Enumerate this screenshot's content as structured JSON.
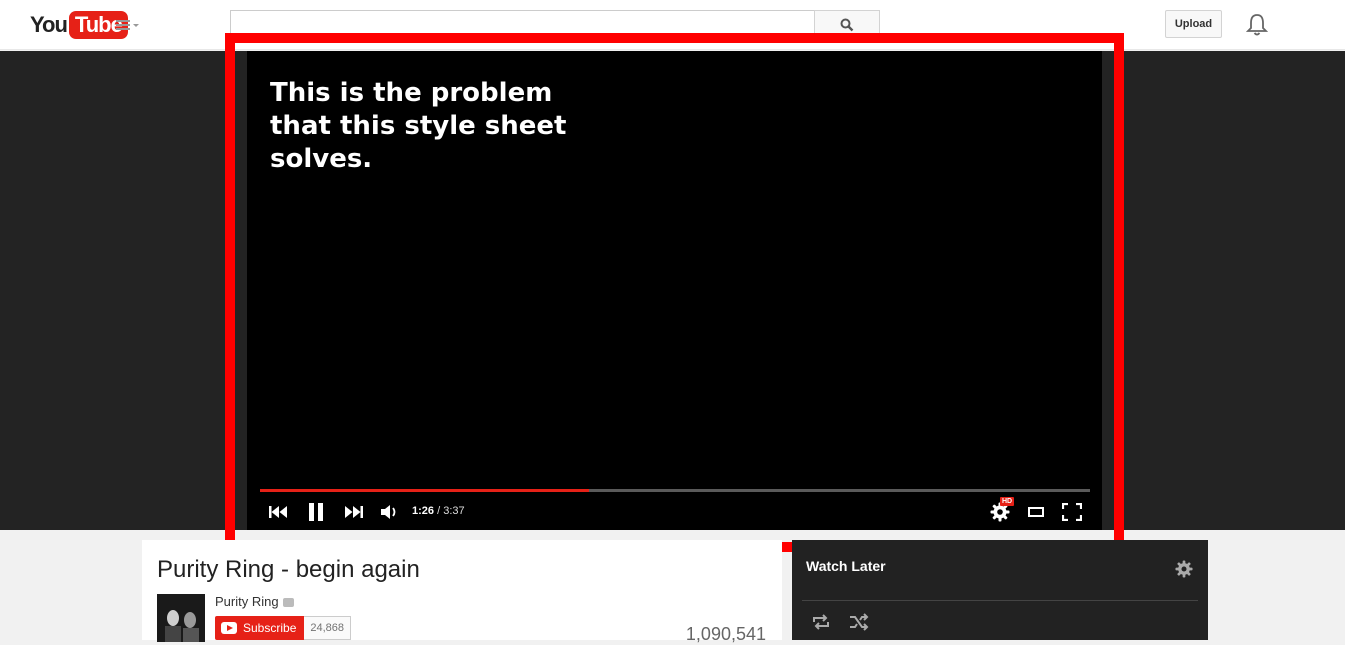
{
  "masthead": {
    "logo_you": "You",
    "logo_tube": "Tube",
    "search_placeholder": "",
    "upload_label": "Upload"
  },
  "player": {
    "caption": "This is the problem that this style sheet solves.",
    "current_time": "1:26",
    "duration": " / 3:37",
    "progress_fraction": 0.396,
    "hd_badge": "HD"
  },
  "video": {
    "title": "Purity Ring - begin again",
    "channel": "Purity Ring",
    "subscribe_label": "Subscribe",
    "subscriber_count": "24,868",
    "views": "1,090,541"
  },
  "playlist": {
    "title": "Watch Later"
  },
  "colors": {
    "brand_red": "#e62117",
    "highlight": "#ff0000"
  }
}
